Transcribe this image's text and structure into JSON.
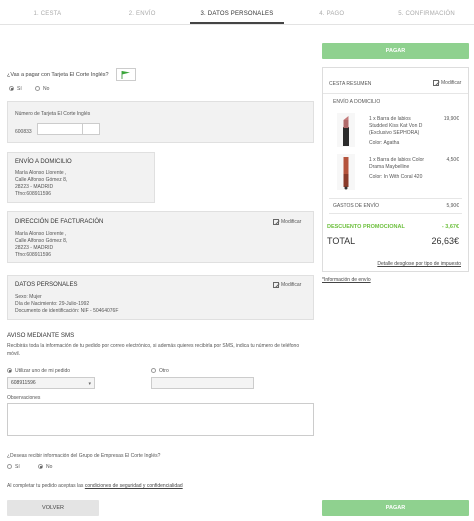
{
  "steps": [
    "1. CESTA",
    "2. ENVÍO",
    "3. DATOS PERSONALES",
    "4. PAGO",
    "5. CONFIRMACIÓN"
  ],
  "pay_button": "PAGAR",
  "card_question": "¿Vas a pagar con Tarjeta El Corte Inglés?",
  "card_options": [
    "Sí",
    "No"
  ],
  "card_number_label": "Número de Tarjeta El Corte Inglés",
  "card_prefix": "600833",
  "shipping": {
    "title": "ENVÍO A DOMICILIO",
    "lines": [
      "María Alonso  Llorente ,",
      "Calle Alfonso Gómez 8,",
      "28223 - MADRID",
      "Tfno:608911596"
    ]
  },
  "billing": {
    "title": "DIRECCIÓN DE FACTURACIÓN",
    "edit": "Modificar",
    "lines": [
      "María Alonso  Llorente ,",
      "Calle Alfonso Gómez 8,",
      "28223 - MADRID",
      "Tfno:608911596"
    ]
  },
  "personal": {
    "title": "DATOS PERSONALES",
    "edit": "Modificar",
    "lines": [
      "Sexo:  Mujer",
      "Día de Nacimiento:  29-Julio-1992",
      "Documento de identificación:  NIF - 50464076F"
    ]
  },
  "sms": {
    "title": "AVISO MEDIANTE SMS",
    "text": "Recibirás toda la información de tu pedido por correo electrónico, si además quieres recibirla por SMS, indica tu número de teléfono móvil.",
    "option_mine": "Utilizar uno de mi pedido",
    "option_other": "Otro",
    "phone_value": "608911596"
  },
  "observations_label": "Observaciones",
  "group_info": {
    "question": "¿Deseas recibir información del Grupo de Empresas El Corte Inglés?",
    "options": [
      "Sí",
      "No"
    ]
  },
  "terms": {
    "prefix": "Al completar tu pedido aceptas las",
    "link": "condiciones de seguridad y confidencialidad"
  },
  "back_button": "VOLVER",
  "summary": {
    "title": "CESTA RESUMEN",
    "edit": "Modificar",
    "section": "ENVÍO A DOMICILIO",
    "items": [
      {
        "name_lines": [
          "1 x Barra de labios",
          "Studded Kiss Kat Von D",
          "(Exclusivo SEPHORA)"
        ],
        "color": "Color: Agatha",
        "price": "19,90€"
      },
      {
        "name_lines": [
          "1 x Barra de labios Color",
          "Drama Maybelline"
        ],
        "color": "Color: In With Coral 420",
        "price": "4,50€"
      }
    ],
    "shipping_label": "GASTOS DE ENVÍO",
    "shipping_value": "5,90€",
    "discount_label": "DESCUENTO PROMOCIONAL",
    "discount_value": "- 3,67€",
    "total_label": "TOTAL",
    "total_value": "26,63€",
    "tax_link": "Detalle desglose por tipo de impuesto",
    "shipping_info_link": "*Información de envío"
  },
  "colors": {
    "green": "#8fd18f",
    "discount": "#6bbf3b"
  }
}
